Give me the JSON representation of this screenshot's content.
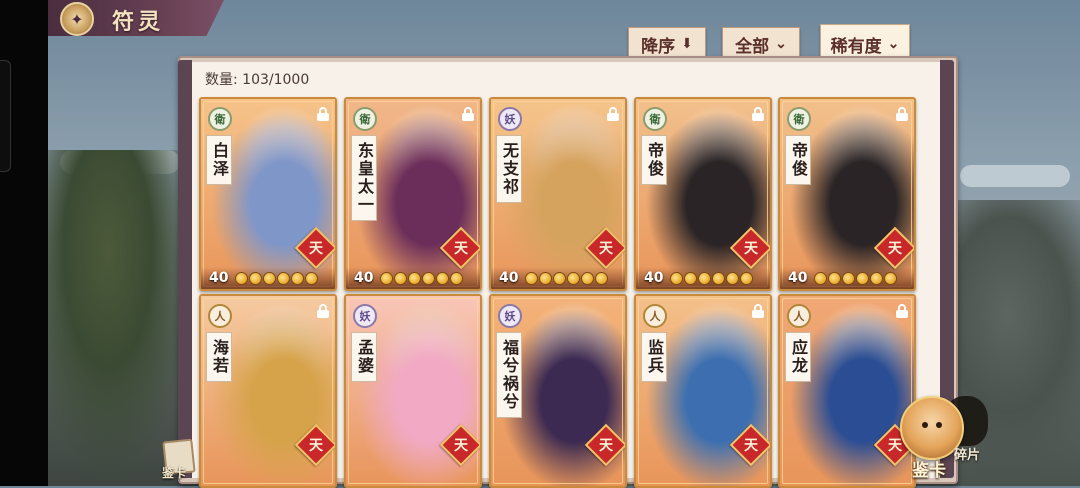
{
  "header": {
    "title": "符灵",
    "emblem": "✦"
  },
  "sort_buttons": [
    {
      "label": "降序",
      "icon": "arrow-down-icon",
      "glyph": "⬇"
    },
    {
      "label": "全部",
      "icon": "chevron-down-icon",
      "glyph": "⌄"
    },
    {
      "label": "稀有度",
      "icon": "chevron-down-icon",
      "glyph": "⌄"
    }
  ],
  "count_text": "数量: 103/1000",
  "cards": [
    {
      "name": "白泽",
      "faction": "衛",
      "faction_type": "wei",
      "level": "40",
      "stars": 6,
      "rank": "天",
      "locked": true,
      "bg": "#f6c38a",
      "accent": "#7f96c9"
    },
    {
      "name": "东皇太一",
      "faction": "衛",
      "faction_type": "wei",
      "level": "40",
      "stars": 6,
      "rank": "天",
      "locked": true,
      "bg": "#f1b78a",
      "accent": "#6b2e5a"
    },
    {
      "name": "无支祁",
      "faction": "妖",
      "faction_type": "yao",
      "level": "40",
      "stars": 6,
      "rank": "天",
      "locked": true,
      "bg": "#f4c58c",
      "accent": "#d6a35e"
    },
    {
      "name": "帝俊",
      "faction": "衛",
      "faction_type": "wei",
      "level": "40",
      "stars": 6,
      "rank": "天",
      "locked": true,
      "bg": "#f2c08c",
      "accent": "#2a2426"
    },
    {
      "name": "帝俊",
      "faction": "衛",
      "faction_type": "wei",
      "level": "40",
      "stars": 6,
      "rank": "天",
      "locked": true,
      "bg": "#f2c08c",
      "accent": "#2a2426"
    },
    {
      "name": "海若",
      "faction": "人",
      "faction_type": "ren",
      "level": "",
      "stars": 0,
      "rank": "天",
      "locked": true,
      "bg": "#f5caa0",
      "accent": "#d6a34a"
    },
    {
      "name": "孟婆",
      "faction": "妖",
      "faction_type": "yao",
      "level": "",
      "stars": 0,
      "rank": "天",
      "locked": false,
      "bg": "#f8c6b8",
      "accent": "#f1a9c4"
    },
    {
      "name": "福兮祸兮",
      "faction": "妖",
      "faction_type": "yao",
      "level": "",
      "stars": 0,
      "rank": "天",
      "locked": false,
      "bg": "#f3b37a",
      "accent": "#3c2a52"
    },
    {
      "name": "监兵",
      "faction": "人",
      "faction_type": "ren",
      "level": "",
      "stars": 0,
      "rank": "天",
      "locked": true,
      "bg": "#f4c08a",
      "accent": "#3d6fb0"
    },
    {
      "name": "应龙",
      "faction": "人",
      "faction_type": "ren",
      "level": "",
      "stars": 0,
      "rank": "天",
      "locked": true,
      "bg": "#f0a876",
      "accent": "#2a4d94"
    }
  ],
  "footer": {
    "pack_label": "鉴卡",
    "mascot_label": "鉴卡",
    "fragment_label": "碎片"
  }
}
